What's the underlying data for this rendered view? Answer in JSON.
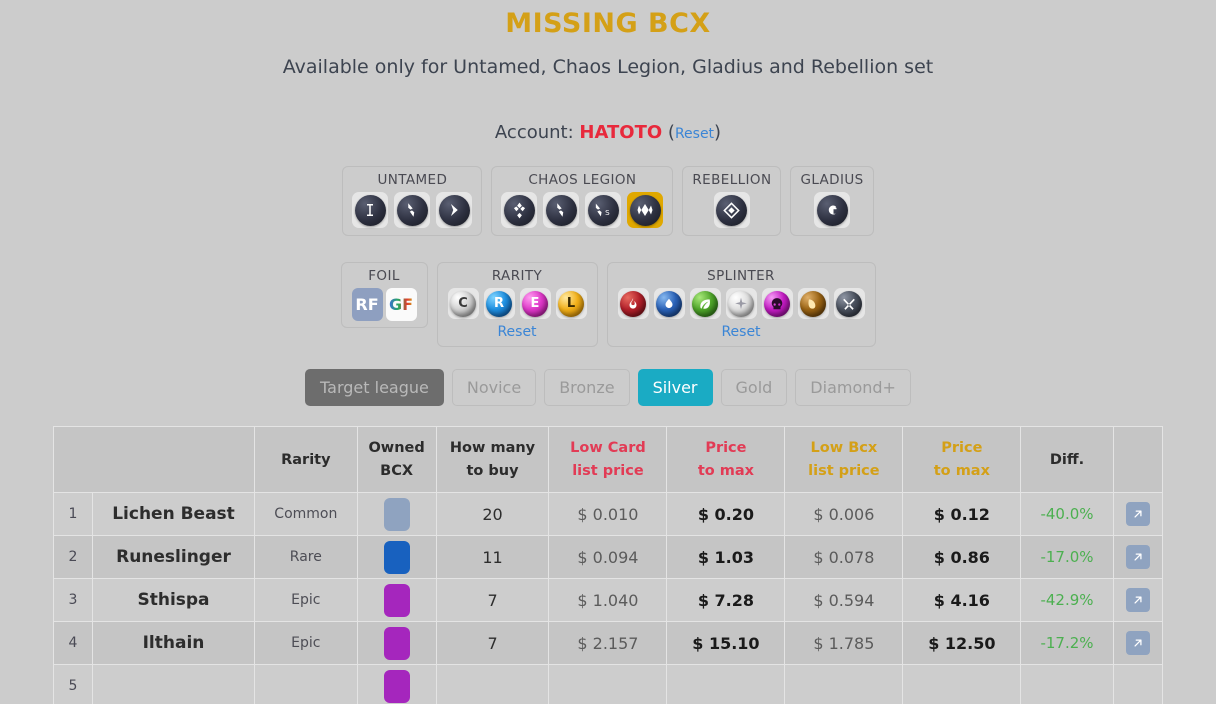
{
  "header": {
    "title": "MISSING BCX",
    "subtitle": "Available only for Untamed, Chaos Legion, Gladius and Rebellion set",
    "account_label": "Account:",
    "account_name": "HATOTO",
    "reset_open": "(",
    "reset_label": "Reset",
    "reset_close": ")"
  },
  "sets": [
    {
      "label": "UNTAMED",
      "icons": [
        {
          "name": "untamed-icon",
          "glyph": "U",
          "selected": false
        },
        {
          "name": "dice-icon",
          "glyph": "dice",
          "selected": false
        },
        {
          "name": "chevron-right-icon",
          "glyph": "chevron",
          "selected": false
        }
      ]
    },
    {
      "label": "CHAOS LEGION",
      "icons": [
        {
          "name": "chaos-legion-icon",
          "glyph": "diamond4",
          "selected": false
        },
        {
          "name": "dice-icon",
          "glyph": "dice",
          "selected": false
        },
        {
          "name": "dice-soulbound-icon",
          "glyph": "diceS",
          "selected": false
        },
        {
          "name": "riftwatchers-icon",
          "glyph": "rift",
          "selected": true
        }
      ]
    },
    {
      "label": "REBELLION",
      "icons": [
        {
          "name": "rebellion-icon",
          "glyph": "rebel",
          "selected": false
        }
      ]
    },
    {
      "label": "GLADIUS",
      "icons": [
        {
          "name": "gladius-icon",
          "glyph": "G",
          "selected": false
        }
      ]
    }
  ],
  "foil": {
    "label": "FOIL",
    "options": [
      {
        "name": "regular-foil-button",
        "label": "RF",
        "selected": true
      },
      {
        "name": "gold-foil-button",
        "label": "GF",
        "selected": false
      }
    ]
  },
  "rarity": {
    "label": "RARITY",
    "reset_label": "Reset",
    "options": [
      {
        "name": "rarity-common",
        "label": "C",
        "cls": "c"
      },
      {
        "name": "rarity-rare",
        "label": "R",
        "cls": "r"
      },
      {
        "name": "rarity-epic",
        "label": "E",
        "cls": "e"
      },
      {
        "name": "rarity-legendary",
        "label": "L",
        "cls": "l"
      }
    ]
  },
  "splinter": {
    "label": "SPLINTER",
    "reset_label": "Reset",
    "options": [
      {
        "name": "splinter-fire",
        "cls": "fire",
        "glyph": "flame"
      },
      {
        "name": "splinter-water",
        "cls": "water",
        "glyph": "droplet"
      },
      {
        "name": "splinter-earth",
        "cls": "earth",
        "glyph": "leaf"
      },
      {
        "name": "splinter-life",
        "cls": "life",
        "glyph": "sun"
      },
      {
        "name": "splinter-death",
        "cls": "death",
        "glyph": "skull"
      },
      {
        "name": "splinter-dragon",
        "cls": "dragon",
        "glyph": "claw"
      },
      {
        "name": "splinter-neutral",
        "cls": "neutral",
        "glyph": "swords"
      }
    ]
  },
  "leagues": {
    "label": "Target league",
    "options": [
      {
        "name": "league-novice",
        "label": "Novice",
        "selected": false
      },
      {
        "name": "league-bronze",
        "label": "Bronze",
        "selected": false
      },
      {
        "name": "league-silver",
        "label": "Silver",
        "selected": true
      },
      {
        "name": "league-gold",
        "label": "Gold",
        "selected": false
      },
      {
        "name": "league-diamond",
        "label": "Diamond+",
        "selected": false
      }
    ]
  },
  "table": {
    "headers": {
      "index": "",
      "card": "",
      "rarity": "Rarity",
      "owned_bcx_l1": "Owned",
      "owned_bcx_l2": "BCX",
      "how_many_l1": "How many",
      "how_many_l2": "to buy",
      "low_card_l1": "Low Card",
      "low_card_l2": "list price",
      "price_max_card_l1": "Price",
      "price_max_card_l2": "to max",
      "low_bcx_l1": "Low Bcx",
      "low_bcx_l2": "list price",
      "price_max_bcx_l1": "Price",
      "price_max_bcx_l2": "to max",
      "diff": "Diff.",
      "link": ""
    },
    "rows": [
      {
        "index": "1",
        "name": "Lichen Beast",
        "rarity": "Common",
        "bcx_color": "#8fa3c0",
        "how_many": "20",
        "low_card": "$ 0.010",
        "price_max_card": "$ 0.20",
        "low_bcx": "$ 0.006",
        "price_max_bcx": "$ 0.12",
        "diff": "-40.0%"
      },
      {
        "index": "2",
        "name": "Runeslinger",
        "rarity": "Rare",
        "bcx_color": "#1861bf",
        "how_many": "11",
        "low_card": "$ 0.094",
        "price_max_card": "$ 1.03",
        "low_bcx": "$ 0.078",
        "price_max_bcx": "$ 0.86",
        "diff": "-17.0%"
      },
      {
        "index": "3",
        "name": "Sthispa",
        "rarity": "Epic",
        "bcx_color": "#a526bd",
        "how_many": "7",
        "low_card": "$ 1.040",
        "price_max_card": "$ 7.28",
        "low_bcx": "$ 0.594",
        "price_max_bcx": "$ 4.16",
        "diff": "-42.9%"
      },
      {
        "index": "4",
        "name": "Ilthain",
        "rarity": "Epic",
        "bcx_color": "#a526bd",
        "how_many": "7",
        "low_card": "$ 2.157",
        "price_max_card": "$ 15.10",
        "low_bcx": "$ 1.785",
        "price_max_bcx": "$ 12.50",
        "diff": "-17.2%"
      },
      {
        "index": "5",
        "name": "",
        "rarity": "",
        "bcx_color": "#a526bd",
        "how_many": "",
        "low_card": "",
        "price_max_card": "",
        "low_bcx": "",
        "price_max_bcx": "",
        "diff": ""
      }
    ]
  },
  "colors": {
    "page_bg": "#cccccc",
    "title": "#d4a017",
    "account": "#e8293c",
    "link": "#3a85d6",
    "league_active": "#1aabc4",
    "crimson_header": "#e23b55",
    "gold_header": "#d4a017",
    "diff_negative": "#4cb050",
    "selected_set": "#e0a800"
  }
}
